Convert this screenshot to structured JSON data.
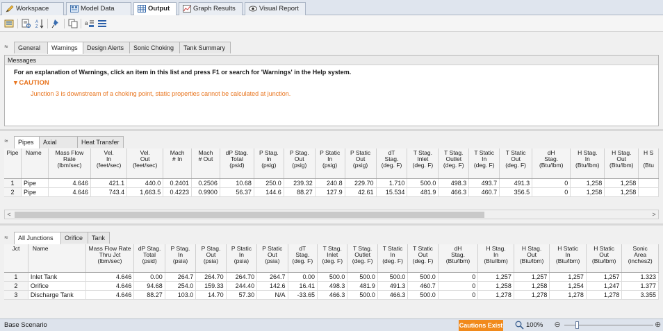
{
  "top_tabs": [
    {
      "label": "Workspace",
      "icon": "pencil-icon"
    },
    {
      "label": "Model Data",
      "icon": "model-data-icon"
    },
    {
      "label": "Output",
      "icon": "output-grid-icon"
    },
    {
      "label": "Graph Results",
      "icon": "graph-icon"
    },
    {
      "label": "Visual Report",
      "icon": "eye-icon"
    }
  ],
  "output_tabs": [
    "General",
    "Warnings",
    "Design Alerts",
    "Sonic Choking",
    "Tank Summary"
  ],
  "messages": {
    "header": "Messages",
    "instruction": "For an explanation of Warnings, click an item in this list and press F1 or search for 'Warnings' in the Help system.",
    "caution_label": "CAUTION",
    "caution_text": "Junction 3 is downstream of a choking point, static properties cannot be calculated at junction."
  },
  "pipe_tabs": [
    "Pipes",
    "Axial Points",
    "Heat Transfer"
  ],
  "pipe_table": {
    "headers": [
      [
        "Pipe"
      ],
      [
        "Name"
      ],
      [
        "Mass Flow",
        "Rate",
        "(lbm/sec)"
      ],
      [
        "Vel.",
        "In",
        "(feet/sec)"
      ],
      [
        "Vel.",
        "Out",
        "(feet/sec)"
      ],
      [
        "Mach",
        "# In"
      ],
      [
        "Mach",
        "# Out"
      ],
      [
        "dP Stag.",
        "Total",
        "(psid)"
      ],
      [
        "P Stag.",
        "In",
        "(psig)"
      ],
      [
        "P Stag.",
        "Out",
        "(psig)"
      ],
      [
        "P Static",
        "In",
        "(psig)"
      ],
      [
        "P Static",
        "Out",
        "(psig)"
      ],
      [
        "dT",
        "Stag.",
        "(deg. F)"
      ],
      [
        "T Stag.",
        "Inlet",
        "(deg. F)"
      ],
      [
        "T Stag.",
        "Outlet",
        "(deg. F)"
      ],
      [
        "T Static",
        "In",
        "(deg. F)"
      ],
      [
        "T Static",
        "Out",
        "(deg. F)"
      ],
      [
        "dH",
        "Stag.",
        "(Btu/lbm)"
      ],
      [
        "H Stag.",
        "In",
        "(Btu/lbm)"
      ],
      [
        "H Stag.",
        "Out",
        "(Btu/lbm)"
      ],
      [
        "H S",
        "",
        "(Btu"
      ]
    ],
    "rows": [
      [
        "1",
        "Pipe",
        "4.646",
        "421.1",
        "440.0",
        "0.2401",
        "0.2506",
        "10.68",
        "250.0",
        "239.32",
        "240.8",
        "229.70",
        "1.710",
        "500.0",
        "498.3",
        "493.7",
        "491.3",
        "0",
        "1,258",
        "1,258",
        ""
      ],
      [
        "2",
        "Pipe",
        "4.646",
        "743.4",
        "1,663.5",
        "0.4223",
        "0.9900",
        "56.37",
        "144.6",
        "88.27",
        "127.9",
        "42.61",
        "15.534",
        "481.9",
        "466.3",
        "460.7",
        "356.5",
        "0",
        "1,258",
        "1,258",
        ""
      ]
    ]
  },
  "junction_tabs": [
    "All Junctions",
    "Orifice",
    "Tank"
  ],
  "junction_table": {
    "headers": [
      [
        "Jct"
      ],
      [
        "Name"
      ],
      [
        "Mass Flow Rate",
        "Thru Jct",
        "(lbm/sec)"
      ],
      [
        "dP Stag.",
        "Total",
        "(psid)"
      ],
      [
        "P Stag.",
        "In",
        "(psia)"
      ],
      [
        "P Stag.",
        "Out",
        "(psia)"
      ],
      [
        "P Static",
        "In",
        "(psia)"
      ],
      [
        "P Static",
        "Out",
        "(psia)"
      ],
      [
        "dT",
        "Stag.",
        "(deg. F)"
      ],
      [
        "T Stag.",
        "Inlet",
        "(deg. F)"
      ],
      [
        "T Stag.",
        "Outlet",
        "(deg. F)"
      ],
      [
        "T Static",
        "In",
        "(deg. F)"
      ],
      [
        "T Static",
        "Out",
        "(deg. F)"
      ],
      [
        "dH",
        "Stag.",
        "(Btu/lbm)"
      ],
      [
        "H Stag.",
        "In",
        "(Btu/lbm)"
      ],
      [
        "H Stag.",
        "Out",
        "(Btu/lbm)"
      ],
      [
        "H Static",
        "In",
        "(Btu/lbm)"
      ],
      [
        "H Static",
        "Out",
        "(Btu/lbm)"
      ],
      [
        "Sonic",
        "Area",
        "(inches2)"
      ]
    ],
    "rows": [
      [
        "1",
        "Inlet Tank",
        "4.646",
        "0.00",
        "264.7",
        "264.70",
        "264.70",
        "264.7",
        "0.00",
        "500.0",
        "500.0",
        "500.0",
        "500.0",
        "0",
        "1,257",
        "1,257",
        "1,257",
        "1,257",
        "1.323"
      ],
      [
        "2",
        "Orifice",
        "4.646",
        "94.68",
        "254.0",
        "159.33",
        "244.40",
        "142.6",
        "16.41",
        "498.3",
        "481.9",
        "491.3",
        "460.7",
        "0",
        "1,258",
        "1,258",
        "1,254",
        "1,247",
        "1.377"
      ],
      [
        "3",
        "Discharge Tank",
        "4.646",
        "88.27",
        "103.0",
        "14.70",
        "57.30",
        "N/A",
        "-33.65",
        "466.3",
        "500.0",
        "466.3",
        "500.0",
        "0",
        "1,278",
        "1,278",
        "1,278",
        "1,278",
        "3.355"
      ]
    ]
  },
  "status": {
    "scenario": "Base Scenario",
    "cautions_button": "Cautions Exist",
    "zoom": "100%",
    "minus": "⊖",
    "plus": "⊕"
  },
  "glyphs": {
    "collapse": "≈",
    "left_arrow": "<",
    "right_arrow": ">"
  },
  "colors": {
    "caution": "#e8731c",
    "cautions_button": "#f18a1c"
  }
}
